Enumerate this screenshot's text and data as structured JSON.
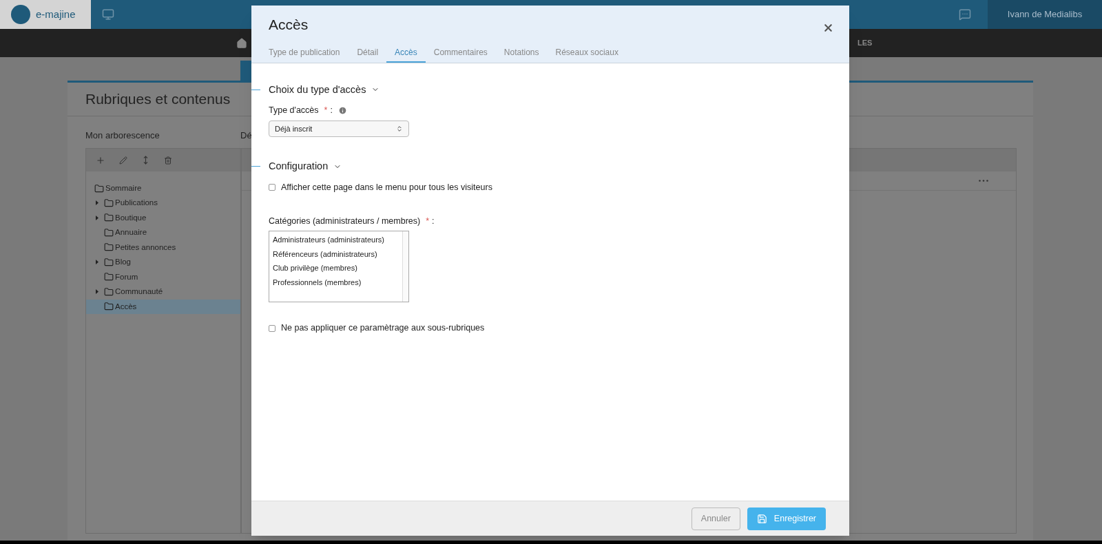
{
  "app": {
    "logo_text": "e-majine",
    "user": "Ivann de Medialibs",
    "nav_fragment": "LES"
  },
  "page": {
    "title": "Rubriques et contenus",
    "tree_label": "Mon arborescence",
    "detail_label_fragment": "Dé"
  },
  "tree": {
    "label": "Sommaire",
    "children": [
      {
        "label": "Publications",
        "expandable": true,
        "selected": false
      },
      {
        "label": "Boutique",
        "expandable": true,
        "selected": false
      },
      {
        "label": "Annuaire",
        "expandable": false,
        "selected": false
      },
      {
        "label": "Petites annonces",
        "expandable": false,
        "selected": false
      },
      {
        "label": "Blog",
        "expandable": true,
        "selected": false
      },
      {
        "label": "Forum",
        "expandable": false,
        "selected": false
      },
      {
        "label": "Communauté",
        "expandable": true,
        "selected": false
      },
      {
        "label": "Accès",
        "expandable": false,
        "selected": true
      }
    ]
  },
  "dialog": {
    "title": "Accès",
    "tabs": [
      {
        "label": "Type de publication",
        "selected": false
      },
      {
        "label": "Détail",
        "selected": false
      },
      {
        "label": "Accès",
        "selected": true
      },
      {
        "label": "Commentaires",
        "selected": false
      },
      {
        "label": "Notations",
        "selected": false
      },
      {
        "label": "Réseaux sociaux",
        "selected": false
      }
    ],
    "sections": [
      {
        "title": "Choix du type d'accès",
        "expanded": true,
        "fields": [
          {
            "kind": "select",
            "label": "Type d'accès",
            "required_mark": "*",
            "colon": ":",
            "info": true,
            "value": "Déjà inscrit"
          }
        ]
      },
      {
        "title": "Configuration",
        "expanded": true,
        "fields": [
          {
            "kind": "checkbox",
            "label": "Afficher cette page dans le menu pour tous les visiteurs",
            "checked": false
          },
          {
            "kind": "listbox",
            "label": "Catégories (administrateurs / membres)",
            "required_mark": "*",
            "colon": ":",
            "options": [
              {
                "label": "Administrateurs (administrateurs)",
                "selected": false
              },
              {
                "label": "Référenceurs (administrateurs)",
                "selected": false
              },
              {
                "label": "Club privilège (membres)",
                "selected": false
              },
              {
                "label": "Professionnels (membres)",
                "selected": false
              }
            ]
          },
          {
            "kind": "checkbox",
            "label": "Ne pas appliquer ce paramètrage aux sous-rubriques",
            "checked": false
          }
        ]
      }
    ],
    "buttons": [
      {
        "kind": "secondary",
        "label": "Annuler"
      },
      {
        "kind": "primary",
        "label": "Enregistrer"
      }
    ]
  }
}
